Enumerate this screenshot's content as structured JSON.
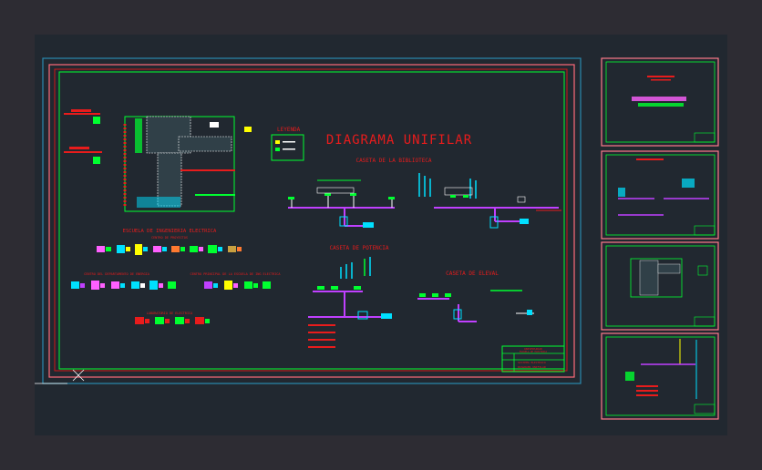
{
  "drawing": {
    "title": "DIAGRAMA UNIFILAR",
    "legend_title": "LEYENDA",
    "sections": {
      "biblioteca": "CASETA DE LA BIBLIOTECA",
      "potencia": "CASETA DE POTENCIA",
      "elevacion": "CASETA DE ELEVAL"
    },
    "school_title": "ESCUELA DE INGENIERIA ELECTRICA",
    "school_subtitle": "CENTRO DE PROYECTOS",
    "sub_left": "CENTRO DEL DEPARTAMENTO DE ENERGIA",
    "sub_right": "CENTRO PRINCIPAL DE LA ESCUELA DE ING ELECTRICA",
    "sub_bottom": "LABORATORIO DE ELECTRICA",
    "title_block": {
      "university": "UNIVERSIDAD",
      "faculty": "ESCUELA DE ELECTRICA",
      "project": "SISTEMA ELECTRICO",
      "sheet": "DIAGRAMA UNIFILAR"
    }
  },
  "colors": {
    "background": "#212830",
    "outer_frame": "#2a7a9a",
    "inner_frame": "#ff7a8a",
    "border": "#00ff30",
    "title_red": "#e81c1c",
    "wire": "#c040ff",
    "cyan": "#00e0ff"
  }
}
